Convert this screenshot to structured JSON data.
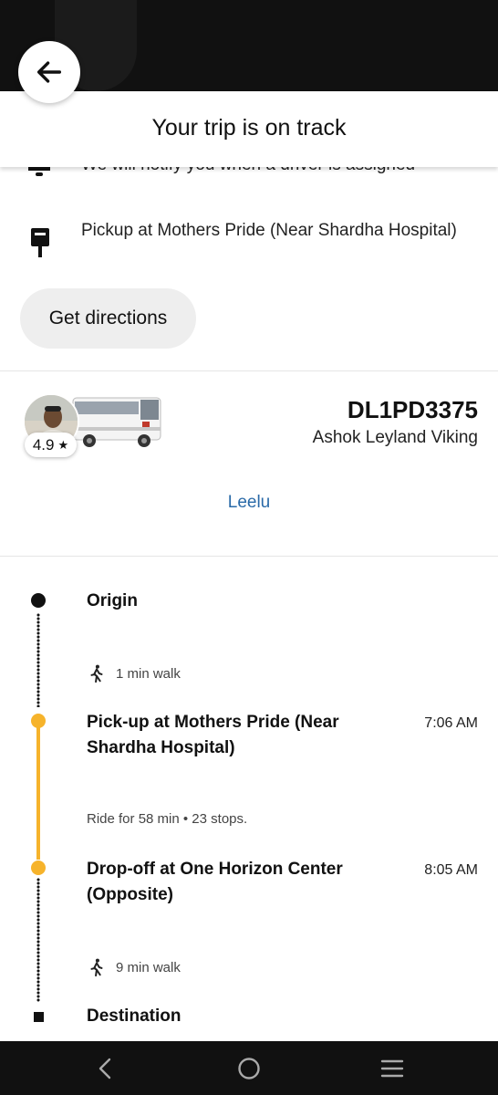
{
  "header": {
    "title": "Your trip is on track"
  },
  "notify": {
    "text": "We will notify you when a driver is assigned"
  },
  "pickup": {
    "text": "Pickup at Mothers Pride (Near Shardha Hospital)"
  },
  "directions_button": {
    "label": "Get directions"
  },
  "driver": {
    "rating": "4.9",
    "name": "Leelu",
    "plate": "DL1PD3375",
    "vehicle_model": "Ashok Leyland Viking"
  },
  "timeline": {
    "origin": {
      "title": "Origin"
    },
    "walk1": {
      "text": "1 min walk"
    },
    "pickup": {
      "title": "Pick-up at Mothers Pride (Near Shardha Hospital)",
      "time": "7:06 AM"
    },
    "ride": {
      "text": "Ride for 58 min • 23 stops."
    },
    "dropoff": {
      "title": "Drop-off at One Horizon Center (Opposite)",
      "time": "8:05 AM"
    },
    "walk2": {
      "text": "9 min walk"
    },
    "destination": {
      "title": "Destination"
    }
  },
  "colors": {
    "accent_orange": "#f6b32b",
    "link_blue": "#2a6aa8",
    "button_grey": "#eeeeee"
  }
}
